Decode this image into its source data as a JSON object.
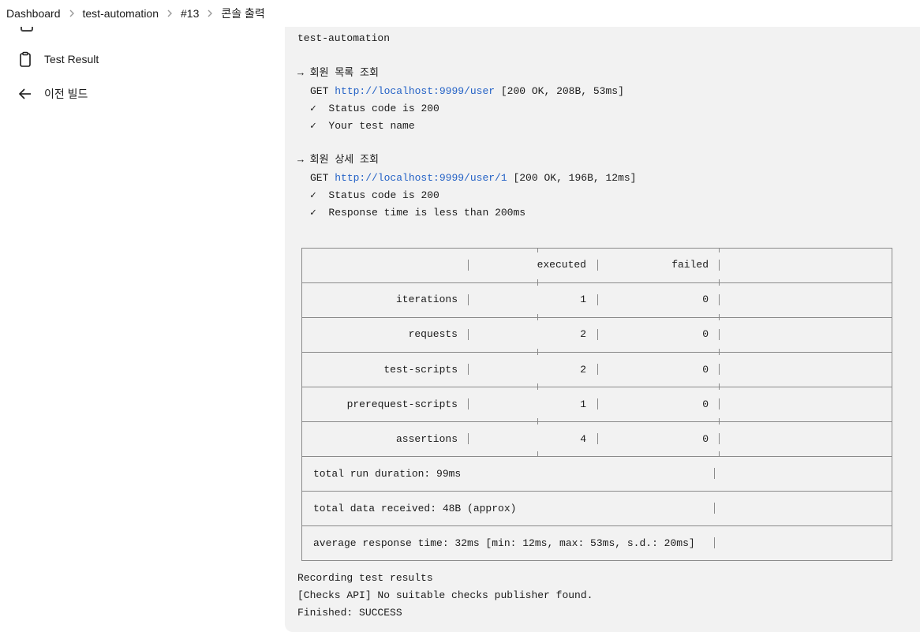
{
  "breadcrumb": {
    "items": [
      "Dashboard",
      "test-automation",
      "#13",
      "콘솔 출력"
    ]
  },
  "sidebar": {
    "test_result": "Test Result",
    "prev_build": "이전 빌드"
  },
  "console": {
    "header": "test-automation",
    "req1_title": "→ 회원 목록 조회",
    "req1_method": "GET ",
    "req1_url": "http://localhost:9999/user",
    "req1_status": " [200 OK, 208B, 53ms]",
    "req1_check1": "✓  Status code is 200",
    "req1_check2": "✓  Your test name",
    "req2_title": "→ 회원 상세 조회",
    "req2_method": "GET ",
    "req2_url": "http://localhost:9999/user/1",
    "req2_status": " [200 OK, 196B, 12ms]",
    "req2_check1": "✓  Status code is 200",
    "req2_check2": "✓  Response time is less than 200ms",
    "table": {
      "headers": [
        "",
        "executed",
        "failed"
      ],
      "rows": [
        {
          "label": "iterations",
          "executed": "1",
          "failed": "0"
        },
        {
          "label": "requests",
          "executed": "2",
          "failed": "0"
        },
        {
          "label": "test-scripts",
          "executed": "2",
          "failed": "0"
        },
        {
          "label": "prerequest-scripts",
          "executed": "1",
          "failed": "0"
        },
        {
          "label": "assertions",
          "executed": "4",
          "failed": "0"
        }
      ],
      "duration": "total run duration: 99ms",
      "data_received": "total data received: 48B (approx)",
      "avg_response": "average response time: 32ms [min: 12ms, max: 53ms, s.d.: 20ms]"
    },
    "footer1": "Recording test results",
    "footer2": "[Checks API] No suitable checks publisher found.",
    "footer3": "Finished: SUCCESS"
  }
}
